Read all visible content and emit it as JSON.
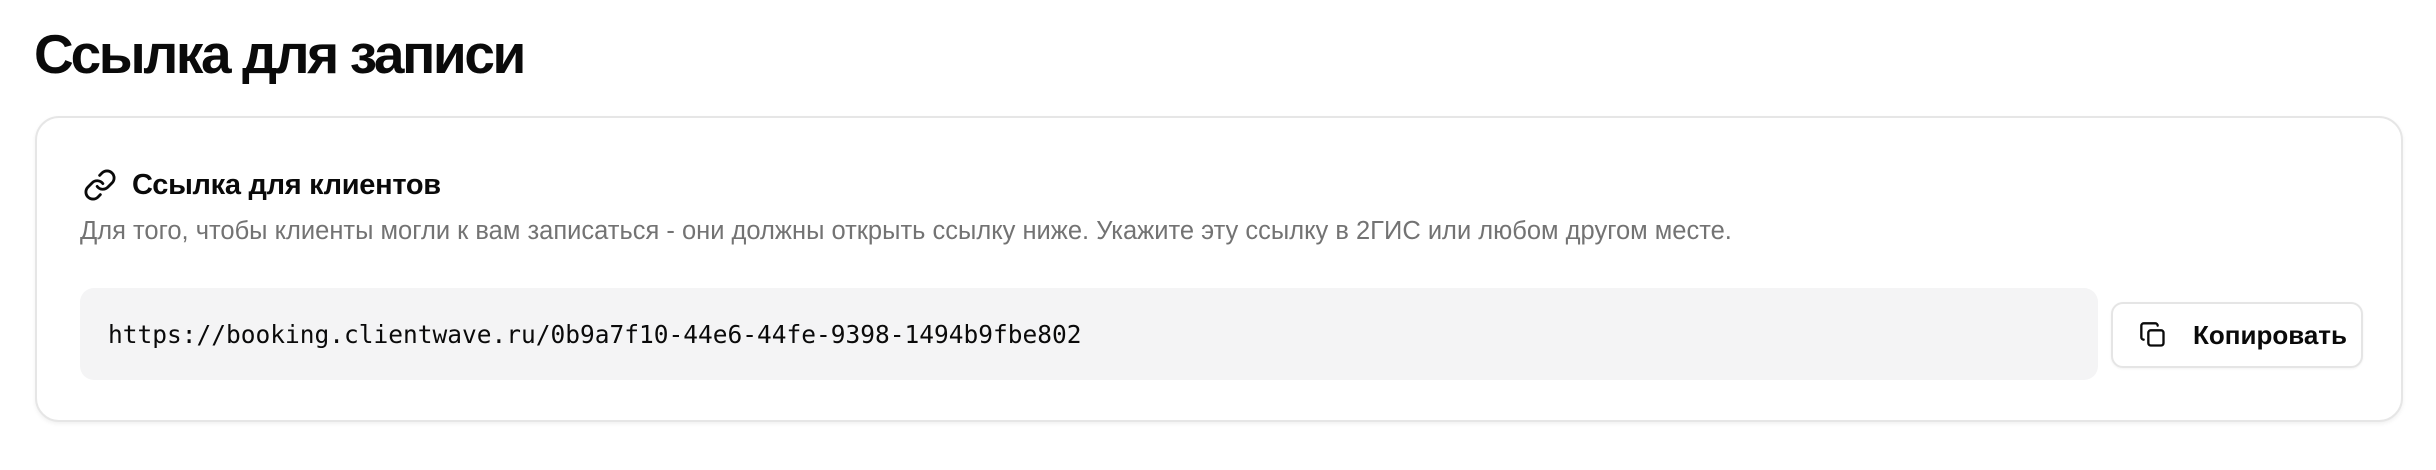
{
  "page": {
    "title": "Ссылка для записи"
  },
  "card": {
    "icon": "link-icon",
    "title": "Ссылка для клиентов",
    "description": "Для того, чтобы клиенты могли к вам записаться - они должны открыть ссылку ниже. Укажите эту ссылку в 2ГИС или любом другом месте.",
    "url": "https://booking.clientwave.ru/0b9a7f10-44e6-44fe-9398-1494b9fbe802",
    "copy_button": {
      "icon": "copy-icon",
      "label": "Копировать"
    }
  }
}
